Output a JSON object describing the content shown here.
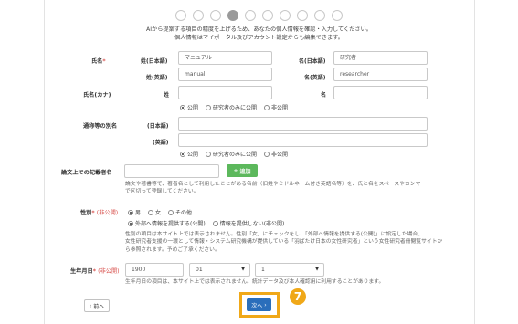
{
  "steps": {
    "total": 10,
    "current": 4
  },
  "intro": {
    "line1": "AIから提案する項目の精度を上げるため、あなたの個人情報を確認・入力してください。",
    "line2": "個人情報はマイポータル及びアカウント設定からも編集できます。"
  },
  "name": {
    "label": "氏名",
    "req": "*",
    "last_ja_label": "姓(日本語)",
    "last_ja_value": "マニュアル",
    "first_ja_label": "名(日本語)",
    "first_ja_value": "研究者",
    "last_en_label": "姓(英語)",
    "last_en_value": "manual",
    "first_en_label": "名(英語)",
    "first_en_value": "researcher"
  },
  "kana": {
    "label": "氏名(カナ)",
    "last_label": "姓",
    "first_label": "名",
    "visibility": [
      "公開",
      "研究者のみに公開",
      "非公開"
    ],
    "selected": 0
  },
  "alias": {
    "label": "通称等の別名",
    "ja_label": "(日本語)",
    "en_label": "(英語)",
    "visibility": [
      "公開",
      "研究者のみに公開",
      "非公開"
    ],
    "selected": 0
  },
  "paper_names": {
    "label": "論文上での記載者名",
    "add_label": "追加",
    "help1": "論文や著書等で、著者名として利用したことがある名前（旧姓やミドルネーム付き英語名等）を、氏と名をスペースやカンマ",
    "help2": "で区切って登録してください。"
  },
  "gender": {
    "label": "性別",
    "req": "*",
    "note": "(非公開)",
    "options": [
      "男",
      "女",
      "その他"
    ],
    "selected": 0,
    "provide": [
      "外部へ情報を提供する(公開)",
      "情報を提供しない(非公開)"
    ],
    "provide_selected": 0,
    "help1": "性別の項目は本サイト上では表示されません。性別「女」にチェックをし、「外部へ情報を提供する(公開)」に設定した場合、",
    "help2": "女性研究者支援の一環として情報・システム研究機構が提供している「羽ばたけ日本の女性研究者」という女性研究者冊閲覧サイトか",
    "help3": "ら参照されます。予めご了承ください。"
  },
  "birth": {
    "label": "生年月日",
    "req": "*",
    "note": "(非公開)",
    "year": "1900",
    "month": "01",
    "day": "1",
    "help": "生年月日の項目は、本サイト上では表示されません。統計データ及び本人確認用に利用することがあります。"
  },
  "nav": {
    "back_label": "前へ",
    "next_label": "次へ"
  },
  "callout": {
    "number": "7"
  },
  "colors": {
    "primary": "#2a6ebb",
    "add": "#5cb85c",
    "highlight": "#f0a818",
    "required": "#d9534f"
  }
}
